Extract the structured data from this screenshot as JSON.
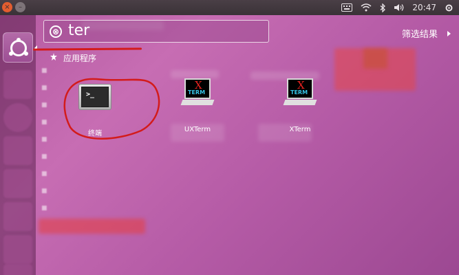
{
  "top_panel": {
    "clock": "20:47",
    "min_glyph": "–",
    "close_glyph": "×"
  },
  "search": {
    "query": "ter",
    "clear_glyph": "⊗"
  },
  "filter": {
    "label": "筛选结果"
  },
  "section": {
    "title": "应用程序"
  },
  "results": [
    {
      "label": "终端",
      "icon": "terminal-icon"
    },
    {
      "label": "UXTerm",
      "icon": "xterm-icon"
    },
    {
      "label": "XTerm",
      "icon": "xterm-icon"
    }
  ],
  "xterm_icon": {
    "x": "X",
    "term": "TERM"
  },
  "terminal_icon": {
    "prompt": ">_"
  },
  "colors": {
    "annotation_red": "#d31b1b",
    "panel_bg": "#3a3237",
    "close_orange": "#e35d2f",
    "dash_tint": "#b45aa0"
  }
}
